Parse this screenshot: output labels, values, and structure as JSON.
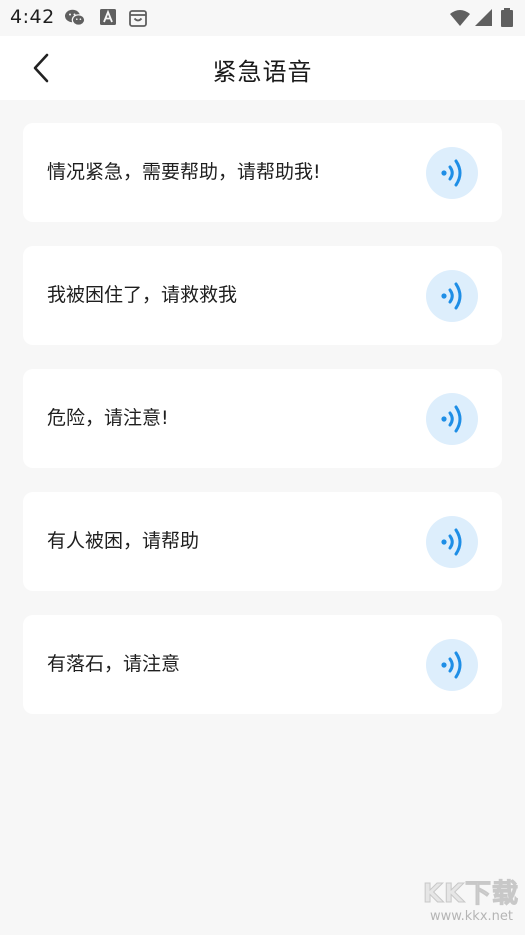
{
  "status_bar": {
    "time": "4:42",
    "left_icons": [
      "wechat-icon",
      "text-app-icon",
      "shopping-bag-icon"
    ],
    "right_icons": [
      "wifi-icon",
      "cellular-signal-icon",
      "battery-icon"
    ]
  },
  "header": {
    "title": "紧急语音",
    "back_icon": "chevron-left-icon"
  },
  "voice_items": [
    {
      "text": "情况紧急，需要帮助，请帮助我!",
      "icon": "speaker-waves-icon"
    },
    {
      "text": "我被困住了，请救救我",
      "icon": "speaker-waves-icon"
    },
    {
      "text": "危险，请注意!",
      "icon": "speaker-waves-icon"
    },
    {
      "text": "有人被困，请帮助",
      "icon": "speaker-waves-icon"
    },
    {
      "text": "有落石，请注意",
      "icon": "speaker-waves-icon"
    }
  ],
  "colors": {
    "background": "#f7f7f7",
    "card": "#ffffff",
    "accent": "#1e8ee6",
    "play_button_bg": "#ddeefc"
  },
  "watermark": {
    "logo": "KK下载",
    "url": "www.kkx.net"
  }
}
